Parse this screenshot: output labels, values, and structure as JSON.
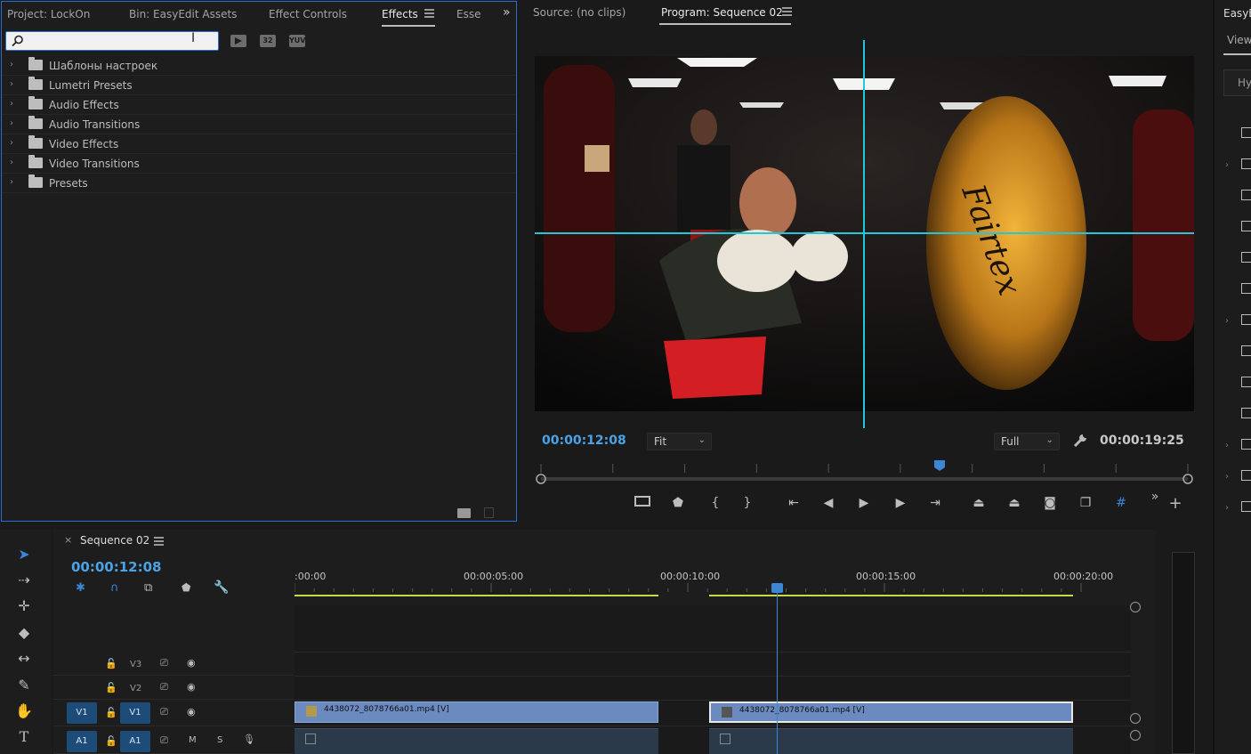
{
  "effects_panel": {
    "tabs": [
      "Project: LockOn",
      "Bin: EasyEdit Assets",
      "Effect Controls",
      "Effects",
      "Esse"
    ],
    "active_tab": "Effects",
    "search_value": "",
    "toolbar_buttons": [
      "32",
      "YUV"
    ],
    "tree_items": [
      "Шаблоны настроек",
      "Lumetri Presets",
      "Audio Effects",
      "Audio Transitions",
      "Video Effects",
      "Video Transitions",
      "Presets"
    ]
  },
  "program_monitor": {
    "source_tab": "Source: (no clips)",
    "program_tab": "Program: Sequence 02",
    "current_timecode": "00:00:12:08",
    "duration_timecode": "00:00:19:25",
    "zoom_value": "Fit",
    "resolution_value": "Full",
    "bag_text": "Fairtex",
    "playhead_fraction": 0.6
  },
  "right_panel": {
    "title": "EasyE",
    "tab": "View",
    "field": "Hy"
  },
  "timeline": {
    "sequence_name": "Sequence 02",
    "timecode": "00:00:12:08",
    "ruler_labels": [
      ":00:00",
      "00:00:05:00",
      "00:00:10:00",
      "00:00:15:00",
      "00:00:20:00"
    ],
    "tracks": {
      "v3": "V3",
      "v2": "V2",
      "v1": "V1",
      "a1": "A1",
      "patch_v1": "V1",
      "patch_a1": "A1",
      "mute": "M",
      "solo": "S"
    },
    "clips": [
      {
        "name": "4438072_8078766a01.mp4 [V]"
      },
      {
        "name": "4438072_8078766a01.mp4 [V]"
      }
    ]
  }
}
